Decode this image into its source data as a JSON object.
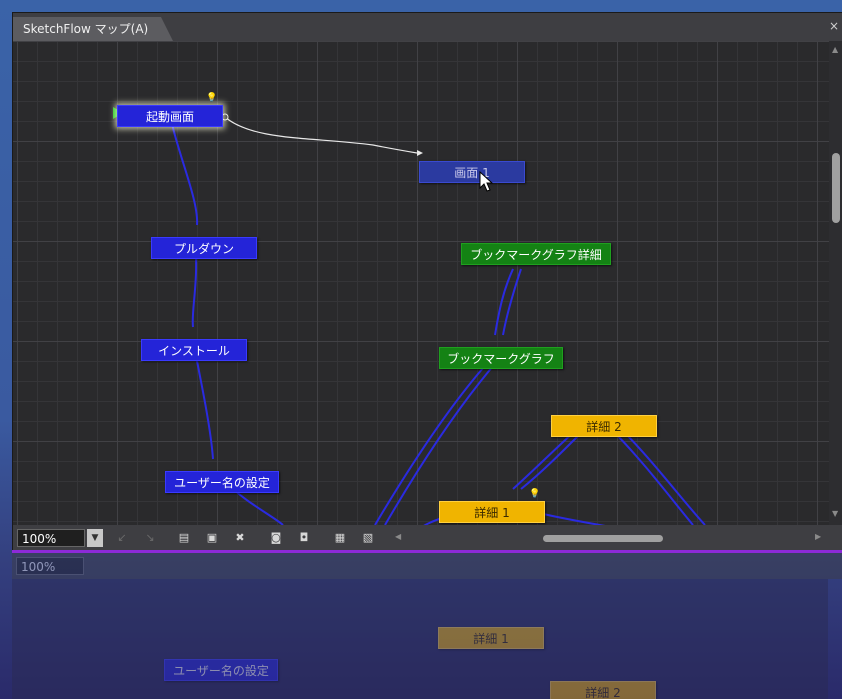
{
  "window": {
    "tab_title": "SketchFlow マップ(A)",
    "close_glyph": "×"
  },
  "nodes": {
    "start": "起動画面",
    "screen1": "画面 1",
    "pulldown": "プルダウン",
    "install": "インストール",
    "username": "ユーザー名の設定",
    "bookmark_detail": "ブックマークグラフ詳細",
    "bookmark": "ブックマークグラフ",
    "detail2": "詳細 2",
    "detail1": "詳細 1"
  },
  "colors": {
    "node_blue": "#2424d8",
    "node_green": "#148214",
    "node_yellow": "#f0b400",
    "accent_purple": "#8c2ad8"
  },
  "toolbar": {
    "zoom_value": "100%",
    "icons": [
      "undo-icon",
      "redo-icon",
      "add-screen-icon",
      "add-component-icon",
      "delete-icon",
      "fit-selection-icon",
      "fit-all-icon",
      "layout-icon",
      "visual-tag-icon"
    ]
  },
  "reflection": {
    "zoom_value": "100%",
    "username": "ユーザー名の設定",
    "detail1": "詳細 1",
    "detail2": "詳細 2"
  }
}
